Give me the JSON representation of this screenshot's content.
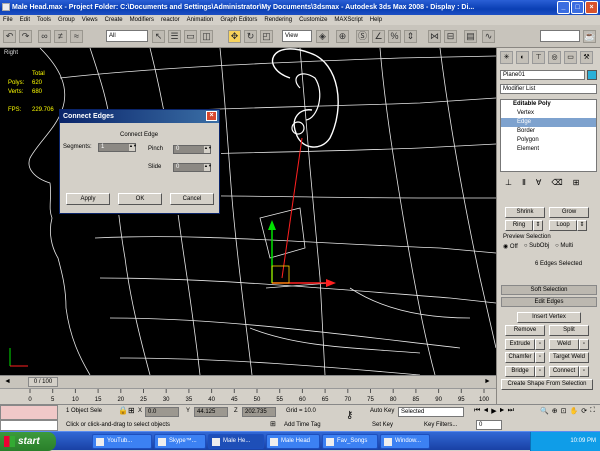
{
  "title": "Male Head.max    - Project Folder: C:\\Documents and Settings\\Administrator\\My Documents\\3dsmax    - Autodesk 3ds Max 2008    - Display : Di...",
  "menu": [
    "File",
    "Edit",
    "Tools",
    "Group",
    "Views",
    "Create",
    "Modifiers",
    "reactor",
    "Animation",
    "Graph Editors",
    "Rendering",
    "Customize",
    "MAXScript",
    "Help"
  ],
  "toolbar": {
    "selection_filter": "All",
    "ref_coord": "View"
  },
  "viewport": {
    "label": "Right",
    "stats": [
      {
        "key": "",
        "value": "Total"
      },
      {
        "key": "Polys:",
        "value": "620"
      },
      {
        "key": "Verts:",
        "value": "680"
      },
      {
        "key": "",
        "value": ""
      },
      {
        "key": "FPS:",
        "value": "229.706"
      }
    ]
  },
  "dialog": {
    "title": "Connect Edges",
    "group_label": "Connect Edge",
    "segments_label": "Segments:",
    "segments_value": "1",
    "pinch_label": "Pinch",
    "pinch_value": "0",
    "slide_label": "Slide",
    "slide_value": "0",
    "apply": "Apply",
    "ok": "OK",
    "cancel": "Cancel"
  },
  "command_panel": {
    "object_name": "Plane01",
    "object_color": "#2ab0d8",
    "modifier_list": "Modifier List",
    "stack": [
      "Editable Poly",
      "Vertex",
      "Edge",
      "Border",
      "Polygon",
      "Element"
    ],
    "selected_stack_index": 2,
    "shrink": "Shrink",
    "grow": "Grow",
    "ring": "Ring",
    "loop": "Loop",
    "preview_selection": "Preview Selection",
    "off": "Off",
    "subobj": "SubObj",
    "multi": "Multi",
    "edges_selected": "6 Edges Selected",
    "soft_selection": "Soft Selection",
    "edit_edges": "Edit Edges",
    "insert_vertex": "Insert Vertex",
    "remove": "Remove",
    "split": "Split",
    "extrude": "Extrude",
    "weld": "Weld",
    "chamfer": "Chamfer",
    "target_weld": "Target Weld",
    "bridge": "Bridge",
    "connect": "Connect",
    "create_shape": "Create Shape From Selection"
  },
  "timeline": {
    "frame": "0 / 100",
    "ticks": [
      "0",
      "5",
      "10",
      "15",
      "20",
      "25",
      "30",
      "35",
      "40",
      "45",
      "50",
      "55",
      "60",
      "65",
      "70",
      "75",
      "80",
      "85",
      "90",
      "95",
      "100"
    ]
  },
  "status": {
    "selected": "1 Object Sele",
    "prompt": "Click or click-and-drag to select objects",
    "x_label": "X",
    "x_value": "0.0",
    "y_label": "Y",
    "y_value": "44.125",
    "z_label": "Z",
    "z_value": "202.735",
    "grid": "Grid = 10.0",
    "add_time_tag": "Add Time Tag",
    "auto_key": "Auto Key",
    "auto_key_value": "Selected",
    "set_key": "Set Key",
    "key_filters": "Key Filters...",
    "frame_value": "0"
  },
  "taskbar": {
    "start": "start",
    "tasks": [
      "YouTub...",
      "Skype™...",
      "Male He...",
      "Male Head",
      "Fav_Songs",
      "Window..."
    ],
    "active_task": 2,
    "clock": "10:09 PM"
  }
}
